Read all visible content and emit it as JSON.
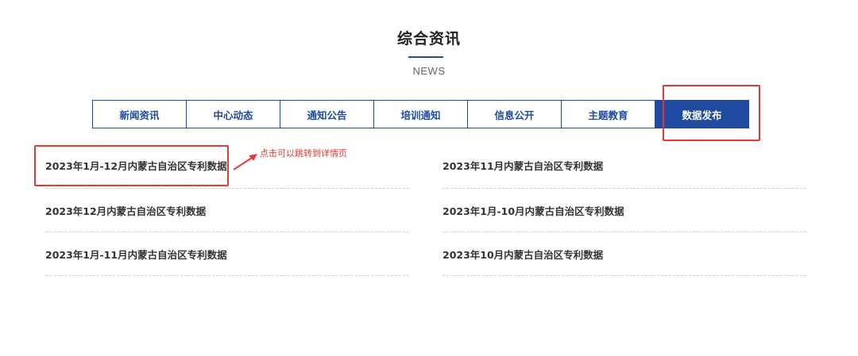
{
  "section": {
    "title": "综合资讯",
    "subtitle": "NEWS"
  },
  "tabs": [
    {
      "label": "新闻资讯",
      "active": false
    },
    {
      "label": "中心动态",
      "active": false
    },
    {
      "label": "通知公告",
      "active": false
    },
    {
      "label": "培训通知",
      "active": false
    },
    {
      "label": "信息公开",
      "active": false
    },
    {
      "label": "主题教育",
      "active": false
    },
    {
      "label": "数据发布",
      "active": true
    }
  ],
  "news_left": [
    "2023年1月-12月内蒙古自治区专利数据",
    "2023年12月内蒙古自治区专利数据",
    "2023年1月-11月内蒙古自治区专利数据"
  ],
  "news_right": [
    "2023年11月内蒙古自治区专利数据",
    "2023年1月-10月内蒙古自治区专利数据",
    "2023年10月内蒙古自治区专利数据"
  ],
  "annotation": {
    "text": "点击可以跳转到详情页"
  },
  "colors": {
    "accent": "#1f4aa0",
    "highlight": "#e53935"
  }
}
